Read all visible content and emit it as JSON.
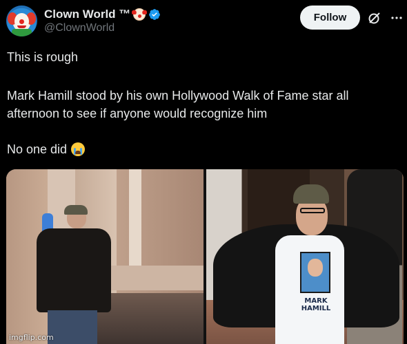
{
  "post": {
    "author_name": "Clown World ™",
    "author_handle": "@ClownWorld",
    "follow_label": "Follow",
    "text_line1": "This is rough",
    "text_line2": "Mark Hamill stood by his own Hollywood Walk of Fame star all",
    "text_line3": "afternoon to see if anyone would recognize him",
    "text_line4": "No one did",
    "emoji_author": "clown-face",
    "emoji_end": "loudly-crying-face"
  },
  "media": {
    "shirt_text": "MARK HAMILL",
    "watermark": "imgflip.com"
  },
  "colors": {
    "background": "#000000",
    "text": "#e7e9ea",
    "muted": "#71767b",
    "verified": "#1d9bf0",
    "follow_bg": "#eff3f4"
  }
}
